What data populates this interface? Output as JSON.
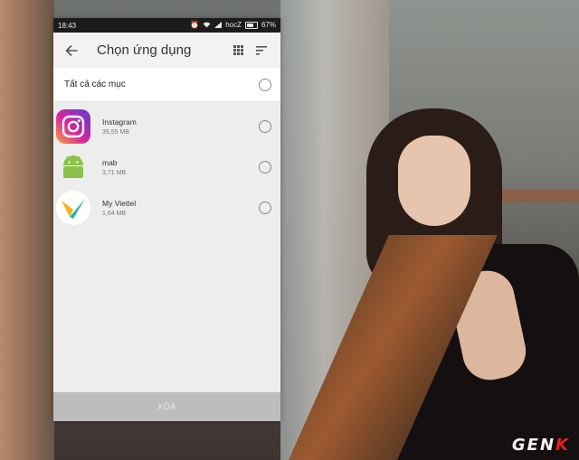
{
  "status_bar": {
    "time": "18:43",
    "carrier": "hocZ",
    "battery": "67%"
  },
  "app_bar": {
    "title": "Chọn ứng dụng"
  },
  "select_all": {
    "label": "Tất cả các mục"
  },
  "apps": [
    {
      "name": "Instagram",
      "size": "35,55 MB",
      "icon": "instagram-icon"
    },
    {
      "name": "mab",
      "size": "3,71 MB",
      "icon": "android-icon"
    },
    {
      "name": "My Viettel",
      "size": "1,64 MB",
      "icon": "viettel-icon"
    }
  ],
  "footer": {
    "delete_label": "XÓA"
  },
  "watermark": {
    "text": "GENK"
  },
  "colors": {
    "footer_bg": "#bdbdbd",
    "list_bg": "#ededed",
    "radio": "#8a8a8a",
    "android_green": "#8bc34a",
    "viettel_teal": "#22b6a7",
    "viettel_yellow": "#f3b51e"
  }
}
